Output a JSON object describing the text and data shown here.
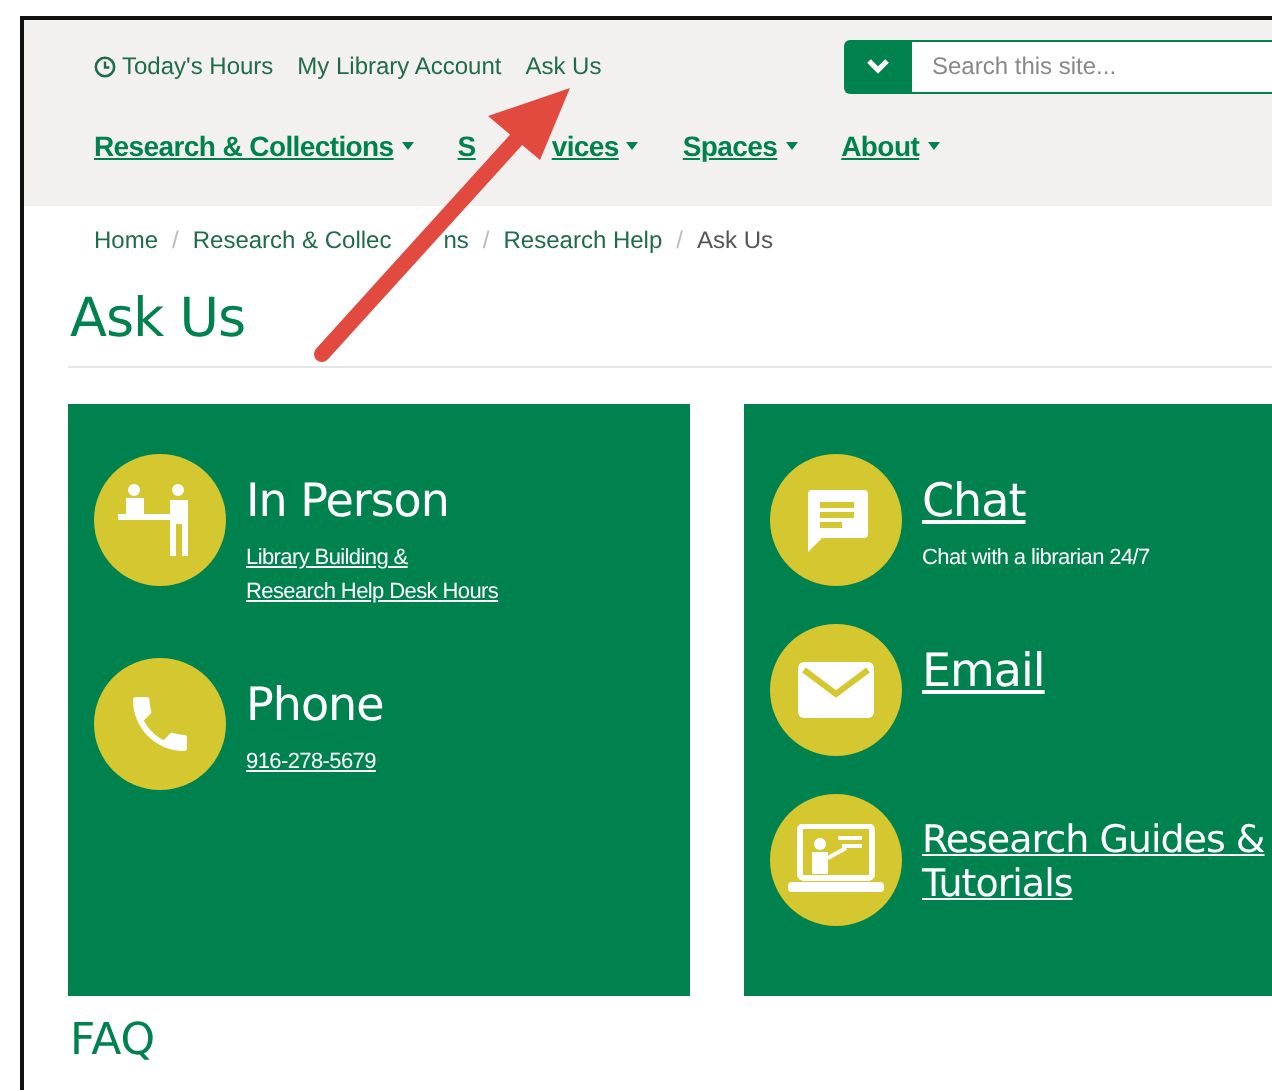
{
  "top_links": [
    {
      "label": "Today's Hours",
      "kind": "hours"
    },
    {
      "label": "My Library Account",
      "kind": "plain"
    },
    {
      "label": "Ask Us",
      "kind": "plain"
    }
  ],
  "search": {
    "placeholder": "Search this site..."
  },
  "nav": [
    {
      "label": "Research & Collections"
    },
    {
      "label_parts": [
        "S",
        "vices"
      ]
    },
    {
      "label": "Spaces"
    },
    {
      "label": "About"
    }
  ],
  "breadcrumbs": [
    {
      "label": "Home",
      "current": false
    },
    {
      "label_parts": [
        "Research & Collec",
        "ns"
      ],
      "current": false,
      "separator": "/"
    },
    {
      "label": "Research Help",
      "current": false,
      "separator": "/"
    },
    {
      "label": "Ask Us",
      "current": true,
      "separator": "/"
    }
  ],
  "title": "Ask Us",
  "panels": [
    {
      "items": [
        {
          "kind": "desk",
          "title": "In Person",
          "title_link": false,
          "detail": {
            "lines": [
              "Library Building &",
              "Research Help Desk Hours"
            ],
            "link": true
          }
        },
        {
          "kind": "phone",
          "title": "Phone",
          "title_link": false,
          "detail": {
            "lines": [
              "916-278-5679"
            ],
            "link": true
          }
        }
      ]
    },
    {
      "items": [
        {
          "kind": "chat",
          "title": "Chat",
          "title_link": true,
          "detail": {
            "lines": [
              "Chat with a librarian 24/7"
            ],
            "link": false
          }
        },
        {
          "kind": "email",
          "title": "Email",
          "title_link": true
        },
        {
          "kind": "tutorial",
          "title_lines": [
            "Research Guides &",
            "Tutorials"
          ],
          "title_link": true
        }
      ]
    }
  ],
  "next_heading": "FAQ"
}
